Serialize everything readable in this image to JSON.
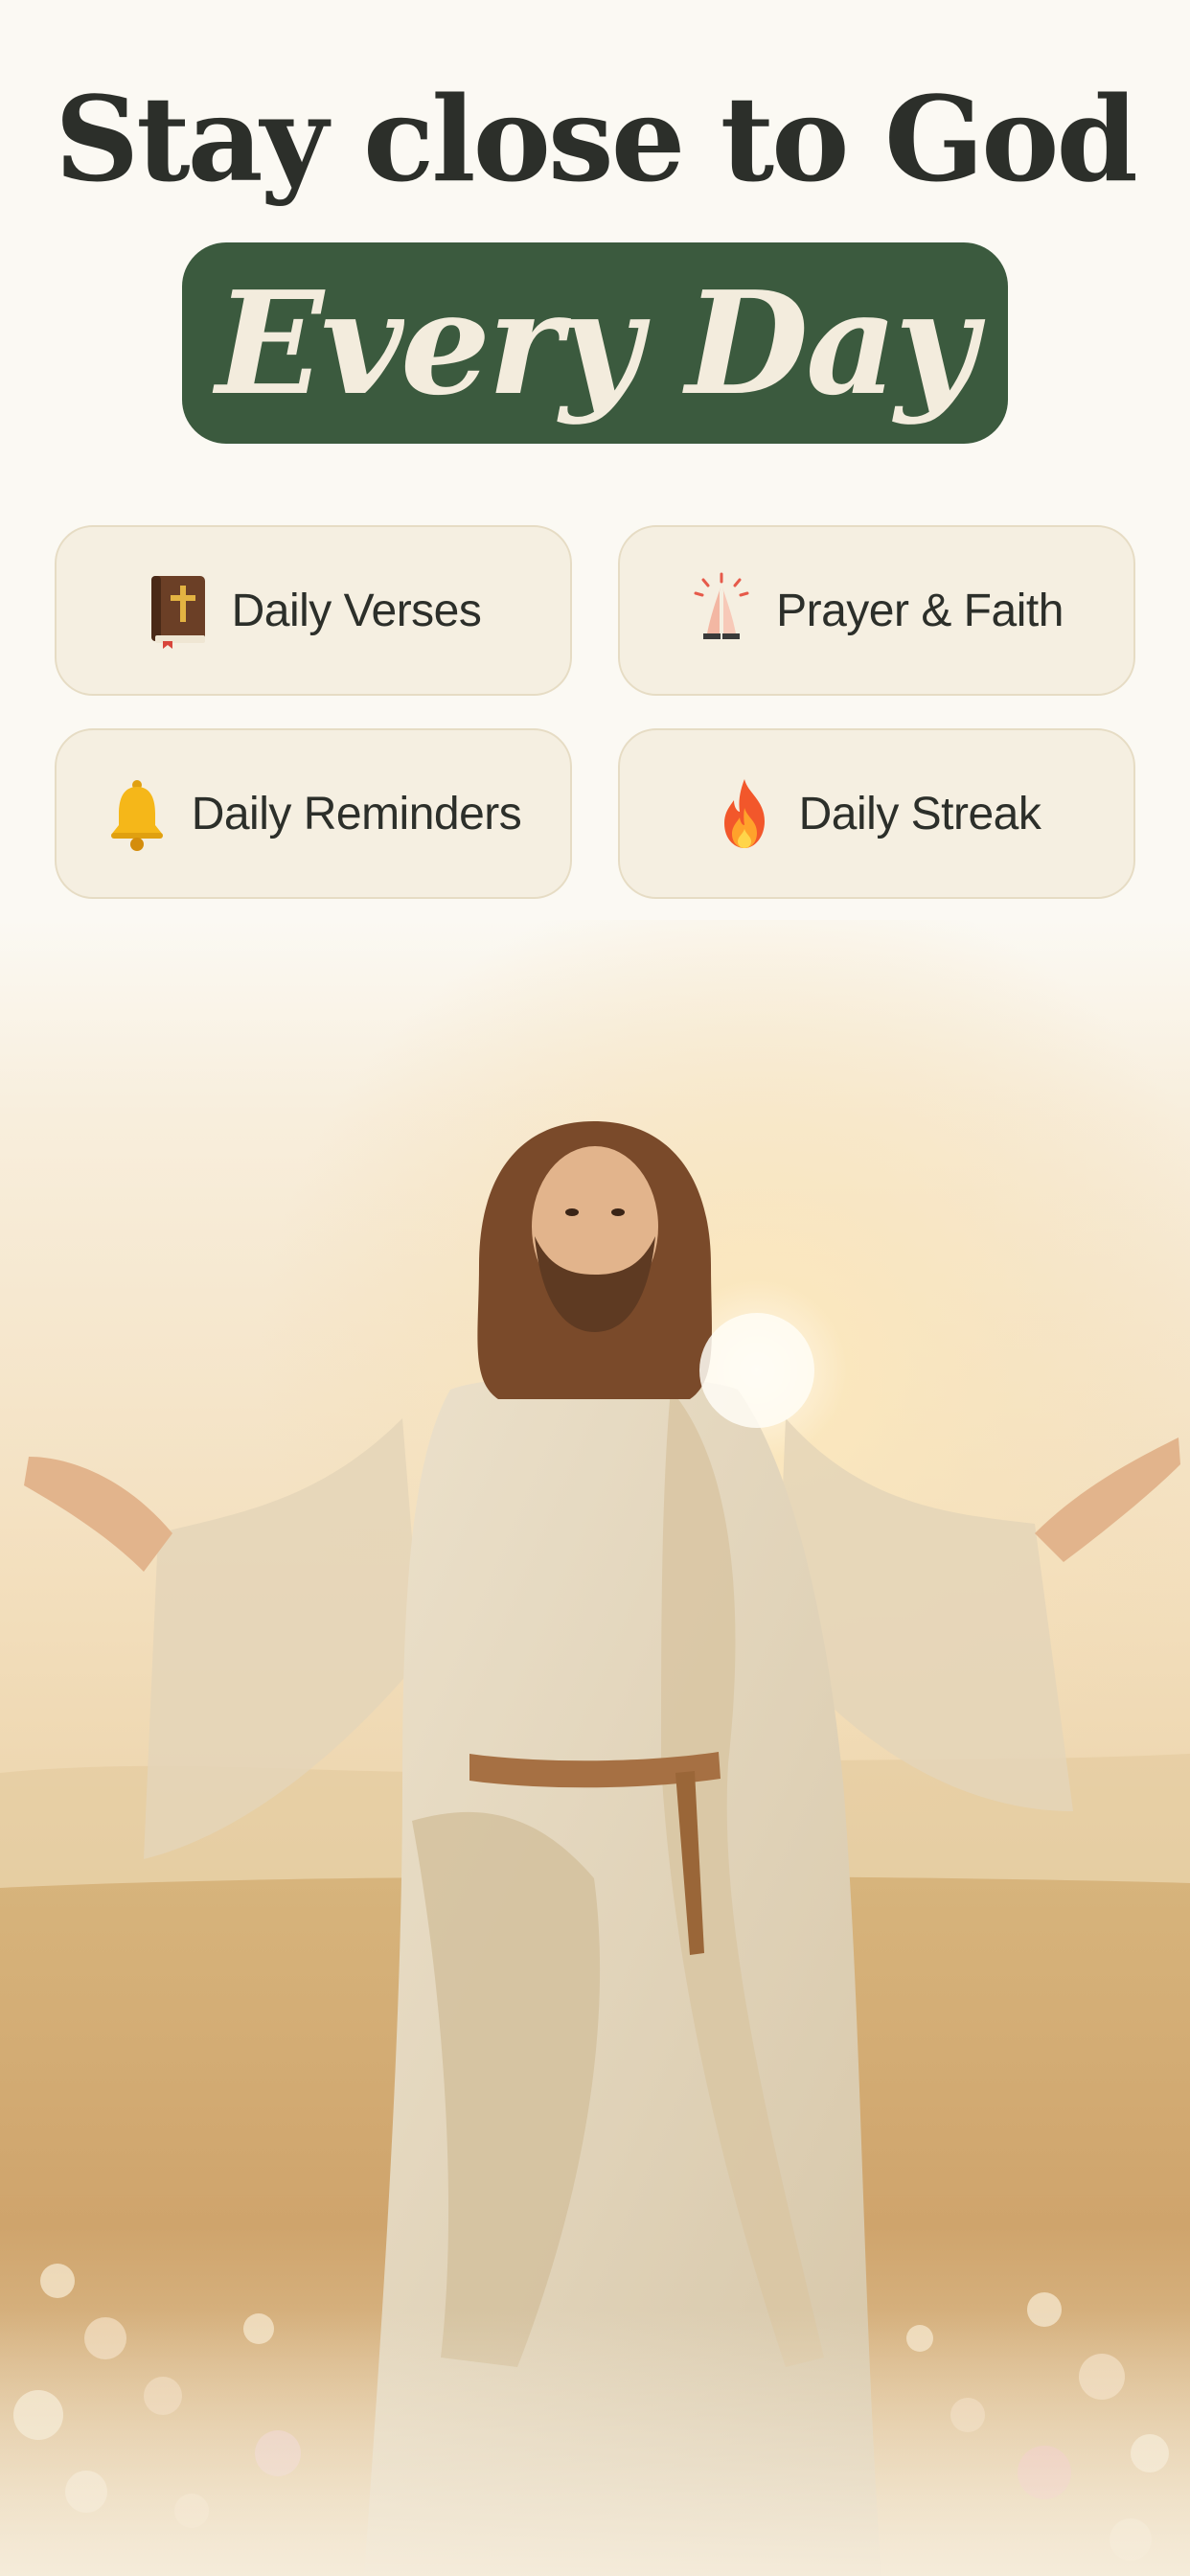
{
  "hero": {
    "title_line1": "Stay close to God",
    "title_line2": "Every Day"
  },
  "features": [
    {
      "label": "Daily Verses",
      "icon": "bible-icon"
    },
    {
      "label": "Prayer & Faith",
      "icon": "praying-hands-icon"
    },
    {
      "label": "Daily Reminders",
      "icon": "bell-icon"
    },
    {
      "label": "Daily Streak",
      "icon": "fire-icon"
    }
  ],
  "colors": {
    "background": "#fbf9f3",
    "title_text": "#2c2f2a",
    "pill_background": "#3b5a3e",
    "pill_text": "#f3ecdd",
    "card_background": "#f5efe1",
    "card_border": "#e6dcc4"
  }
}
